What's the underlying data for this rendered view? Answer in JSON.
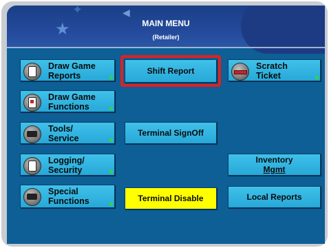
{
  "header": {
    "title": "MAIN MENU",
    "subtitle": "(Retailer)"
  },
  "left_buttons": [
    {
      "line1": "Draw Game",
      "line2": "Reports",
      "icon": "document-icon"
    },
    {
      "line1": "Draw Game",
      "line2": "Functions",
      "icon": "lottery-terminal-icon"
    },
    {
      "line1": "Tools/",
      "line2": "Service",
      "icon": "keypad-icon"
    },
    {
      "line1": "Logging/",
      "line2": "Security",
      "icon": "document-icon"
    },
    {
      "line1": "Special",
      "line2": "Functions",
      "icon": "keypad-icon"
    }
  ],
  "middle_buttons": {
    "shift_report": "Shift Report",
    "terminal_signoff": "Terminal SignOff",
    "terminal_disable": "Terminal Disable"
  },
  "right_buttons": {
    "scratch_ticket": {
      "line1": "Scratch",
      "line2": "Ticket",
      "icon": "scratch-ticket-icon"
    },
    "inventory_mgmt": {
      "line1": "Inventory",
      "line2": "Mgmt"
    },
    "local_reports": "Local Reports"
  },
  "colors": {
    "screen_bg": "#0d5f95",
    "button": "#2fb3e0",
    "disable_button": "#ffff00",
    "selection": "#e02020"
  }
}
